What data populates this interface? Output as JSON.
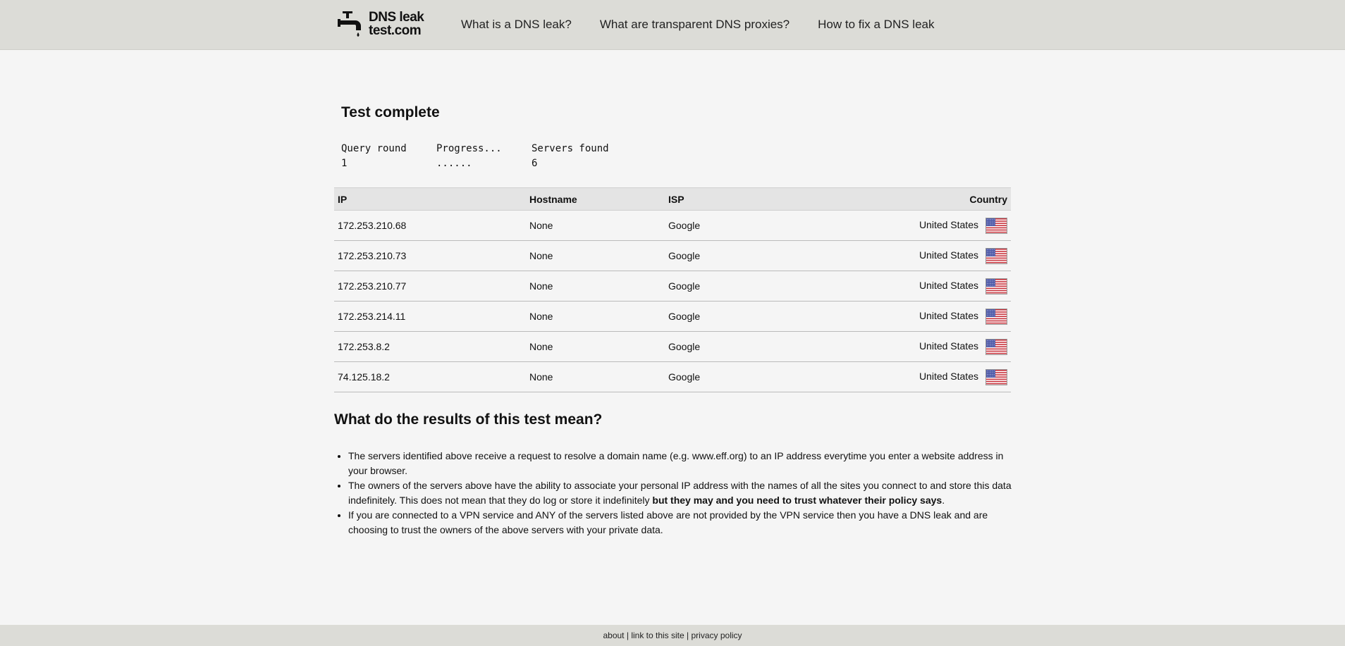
{
  "header": {
    "logo_line1": "DNS leak",
    "logo_line2": "test.com",
    "nav": [
      "What is a DNS leak?",
      "What are transparent DNS proxies?",
      "How to fix a DNS leak"
    ]
  },
  "test": {
    "title": "Test complete",
    "query_round_label": "Query round",
    "progress_label": "Progress...",
    "servers_found_label": "Servers found",
    "query_round_value": "1",
    "progress_value": "......",
    "servers_found_value": "6"
  },
  "table": {
    "headers": {
      "ip": "IP",
      "hostname": "Hostname",
      "isp": "ISP",
      "country": "Country"
    },
    "rows": [
      {
        "ip": "172.253.210.68",
        "hostname": "None",
        "isp": "Google",
        "country": "United States",
        "flag_icon": "us-flag-icon"
      },
      {
        "ip": "172.253.210.73",
        "hostname": "None",
        "isp": "Google",
        "country": "United States",
        "flag_icon": "us-flag-icon"
      },
      {
        "ip": "172.253.210.77",
        "hostname": "None",
        "isp": "Google",
        "country": "United States",
        "flag_icon": "us-flag-icon"
      },
      {
        "ip": "172.253.214.11",
        "hostname": "None",
        "isp": "Google",
        "country": "United States",
        "flag_icon": "us-flag-icon"
      },
      {
        "ip": "172.253.8.2",
        "hostname": "None",
        "isp": "Google",
        "country": "United States",
        "flag_icon": "us-flag-icon"
      },
      {
        "ip": "74.125.18.2",
        "hostname": "None",
        "isp": "Google",
        "country": "United States",
        "flag_icon": "us-flag-icon"
      }
    ]
  },
  "meaning": {
    "title": "What do the results of this test mean?",
    "bullet1": "The servers identified above receive a request to resolve a domain name (e.g. www.eff.org) to an IP address everytime you enter a website address in your browser.",
    "bullet2_plain": "The owners of the servers above have the ability to associate your personal IP address with the names of all the sites you connect to and store this data indefinitely. This does not mean that they do log or store it indefinitely ",
    "bullet2_bold": "but they may and you need to trust whatever their policy says",
    "bullet2_end": ".",
    "bullet3": "If you are connected to a VPN service and ANY of the servers listed above are not provided by the VPN service then you have a DNS leak and are choosing to trust the owners of the above servers with your private data."
  },
  "footer": {
    "about": "about",
    "sep": "|",
    "link": "link to this site",
    "privacy": "privacy policy"
  },
  "colors": {
    "header_bg": "#dcdcd7",
    "page_bg": "#f5f5f5",
    "table_header_bg": "#e4e4e4"
  }
}
